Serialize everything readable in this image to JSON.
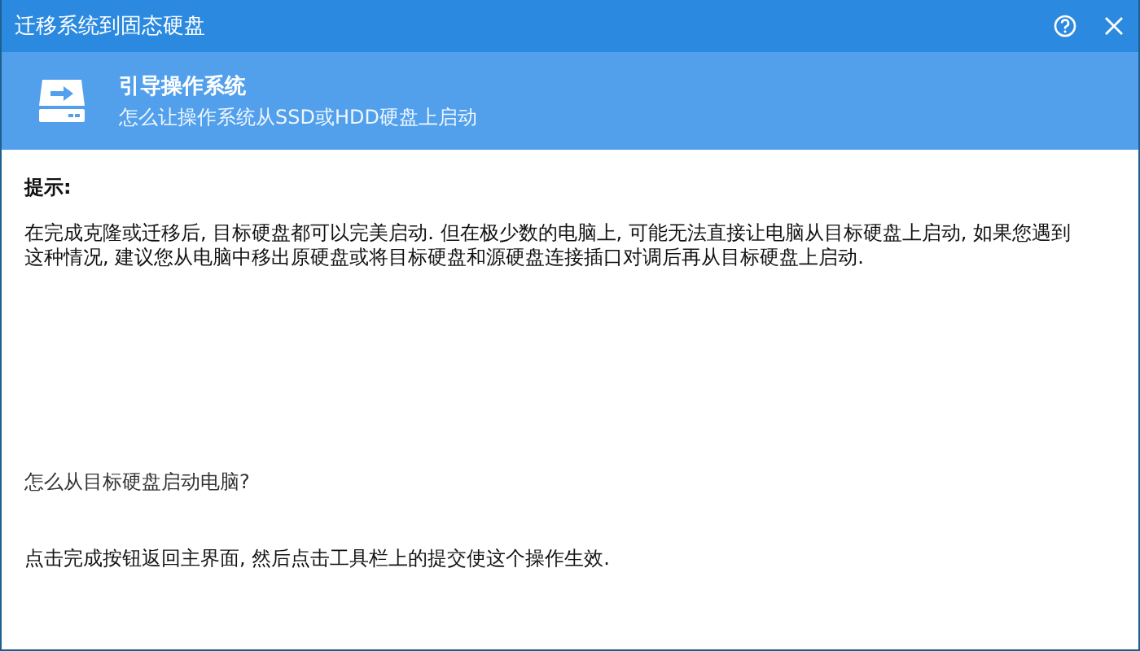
{
  "window": {
    "title": "迁移系统到固态硬盘"
  },
  "header": {
    "title": "引导操作系统",
    "subtitle": "怎么让操作系统从SSD或HDD硬盘上启动"
  },
  "tip": {
    "heading": "提示:",
    "text": "在完成克隆或迁移后, 目标硬盘都可以完美启动. 但在极少数的电脑上, 可能无法直接让电脑从目标硬盘上启动, 如果您遇到这种情况, 建议您从电脑中移出原硬盘或将目标硬盘和源硬盘连接插口对调后再从目标硬盘上启动."
  },
  "question": "怎么从目标硬盘启动电脑?",
  "answer": "点击完成按钮返回主界面, 然后点击工具栏上的提交使这个操作生效."
}
